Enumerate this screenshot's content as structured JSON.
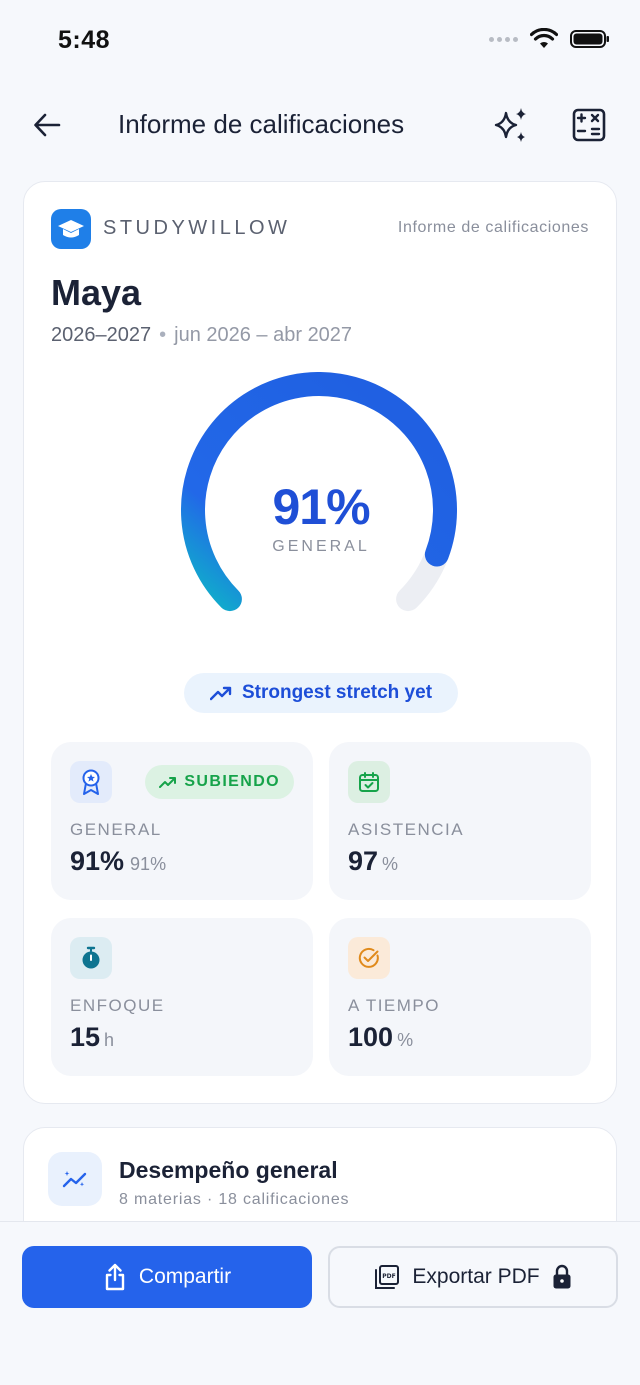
{
  "status_bar": {
    "time": "5:48"
  },
  "nav": {
    "title": "Informe de calificaciones"
  },
  "report": {
    "brand": "STUDYWILLOW",
    "report_label": "Informe de calificaciones",
    "student_name": "Maya",
    "school_year": "2026–2027",
    "date_range": "jun 2026 – abr 2027",
    "gauge": {
      "value": "91%",
      "label": "GENERAL",
      "percent": 91
    },
    "highlight": "Strongest stretch yet",
    "stats": [
      {
        "label": "GENERAL",
        "value": "91%",
        "unit": "91%",
        "badge": "SUBIENDO",
        "icon": "award-icon",
        "icon_bg": "#e3ebfb",
        "icon_color": "#2563eb"
      },
      {
        "label": "ASISTENCIA",
        "value": "97",
        "unit": "%",
        "icon": "calendar-check-icon",
        "icon_bg": "#dcefe2",
        "icon_color": "#16a34a"
      },
      {
        "label": "ENFOQUE",
        "value": "15",
        "unit": "h",
        "icon": "stopwatch-icon",
        "icon_bg": "#dcecf2",
        "icon_color": "#0e7490"
      },
      {
        "label": "A TIEMPO",
        "value": "100",
        "unit": "%",
        "icon": "check-circle-icon",
        "icon_bg": "#fbead9",
        "icon_color": "#e08a1c"
      }
    ]
  },
  "performance": {
    "title": "Desempeño general",
    "subtitle": "8 materias · 18 calificaciones"
  },
  "actions": {
    "share_label": "Compartir",
    "export_label": "Exportar PDF"
  },
  "colors": {
    "primary": "#2563eb",
    "gauge_start": "#0eb5c8",
    "gauge_end": "#1d4ed8",
    "success": "#16a34a"
  }
}
